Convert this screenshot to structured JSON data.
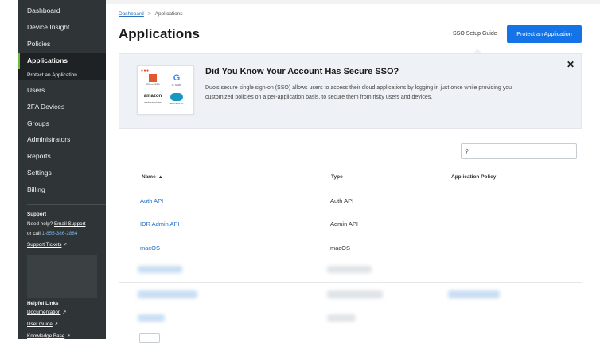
{
  "sidebar": {
    "items": [
      {
        "label": "Dashboard"
      },
      {
        "label": "Device Insight"
      },
      {
        "label": "Policies"
      },
      {
        "label": "Applications"
      },
      {
        "label": "Users"
      },
      {
        "label": "2FA Devices"
      },
      {
        "label": "Groups"
      },
      {
        "label": "Administrators"
      },
      {
        "label": "Reports"
      },
      {
        "label": "Settings"
      },
      {
        "label": "Billing"
      }
    ],
    "sub_item": "Protect an Application",
    "support": {
      "heading": "Support",
      "need_help": "Need help?",
      "email_link": "Email Support",
      "or_call": "or call",
      "phone": "1-855-386-2884",
      "tickets": "Support Tickets"
    },
    "helpful": {
      "heading": "Helpful Links",
      "links": [
        "Documentation",
        "User Guide",
        "Knowledge Base"
      ]
    }
  },
  "main": {
    "breadcrumb": {
      "root": "Dashboard",
      "sep": ">",
      "current": "Applications"
    },
    "title": "Applications",
    "guide_link": "SSO Setup Guide",
    "primary_button": "Protect an Application",
    "sso": {
      "title": "Did You Know Your Account Has Secure SSO?",
      "body": "Duo's secure single sign-on (SSO) allows users to access their cloud applications by logging in just once while providing you customized policies on a per-application basis, to secure them from risky users and devices.",
      "close": "✕",
      "logos": [
        {
          "icon": "office-365-logo",
          "caption": "Office 365"
        },
        {
          "icon": "g-suite-logo",
          "glyph": "G",
          "caption": "G Suite"
        },
        {
          "icon": "amazon-web-services-logo",
          "glyph": "amazon",
          "caption": "web services"
        },
        {
          "icon": "salesforce-logo",
          "caption": "salesforce"
        }
      ],
      "dots": "●●●"
    },
    "search": {
      "icon": "⚲"
    },
    "table": {
      "headers": {
        "name": "Name",
        "sort": "▲",
        "type": "Type",
        "policy": "Application Policy"
      },
      "rows": [
        {
          "name": "Auth API",
          "type": "Auth API",
          "policy": ""
        },
        {
          "name": "IDR Admin API",
          "type": "Admin API",
          "policy": ""
        },
        {
          "name": "macOS",
          "type": "macOS",
          "policy": ""
        }
      ]
    }
  },
  "colors": {
    "sidebar": "#2f3437",
    "accent": "#1473e6",
    "active_marker": "#6dbb3c",
    "link": "#1f6bc4"
  }
}
